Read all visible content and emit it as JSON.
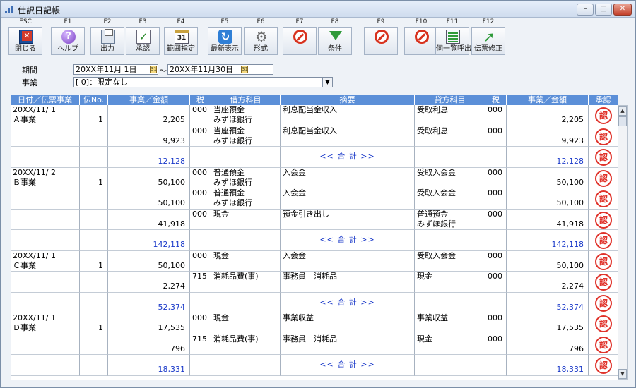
{
  "window": {
    "title": "仕訳日記帳",
    "controls": {
      "minimize": "–",
      "maximize": "□",
      "close": "✕"
    }
  },
  "toolbar": [
    {
      "key": "ESC",
      "label": "閉じる",
      "icon": "close-window-icon"
    },
    {
      "key": "F1",
      "label": "ヘルプ",
      "icon": "help-icon"
    },
    {
      "key": "F2",
      "label": "出力",
      "icon": "print-icon"
    },
    {
      "key": "F3",
      "label": "承認",
      "icon": "approve-check-icon"
    },
    {
      "key": "F4",
      "label": "範囲指定",
      "icon": "calendar-icon",
      "icon_text": "31"
    },
    {
      "key": "F5",
      "label": "最新表示",
      "icon": "refresh-icon"
    },
    {
      "key": "F6",
      "label": "形式",
      "icon": "gear-icon"
    },
    {
      "key": "F7",
      "label": "",
      "icon": "disabled-icon"
    },
    {
      "key": "F8",
      "label": "条件",
      "icon": "filter-icon"
    },
    {
      "key": "F9",
      "label": "",
      "icon": "disabled-icon"
    },
    {
      "key": "F10",
      "label": "",
      "icon": "disabled-icon"
    },
    {
      "key": "F11",
      "label": "伺一覧呼出",
      "icon": "list-icon"
    },
    {
      "key": "F12",
      "label": "伝票修正",
      "icon": "edit-arrow-icon"
    }
  ],
  "filters": {
    "period_label": "期間",
    "period_from": "20XX年11月 1日",
    "period_separator": "～",
    "period_to": "20XX年11月30日",
    "business_label": "事業",
    "business_value": "[      0]：限定なし"
  },
  "grid": {
    "headers": [
      "日付／伝票事業",
      "伝No.",
      "事業／金額",
      "税",
      "借方科目",
      "摘要",
      "貸方科目",
      "税",
      "事業／金額",
      "承認"
    ],
    "total_label": "<< 合  計 >>",
    "approval_stamp": "認",
    "rows": [
      {
        "date": "20XX/11/ 1",
        "biz": "Ａ事業",
        "no": "1",
        "d_amount": "2,205",
        "d_tax": "000",
        "d_acct": "当座預金",
        "d_sub": "みずほ銀行",
        "memo": "利息配当金収入",
        "c_acct": "受取利息",
        "c_sub": "",
        "c_tax": "000",
        "c_amount": "2,205"
      },
      {
        "date": "",
        "biz": "",
        "no": "",
        "d_amount": "9,923",
        "d_tax": "000",
        "d_acct": "当座預金",
        "d_sub": "みずほ銀行",
        "memo": "利息配当金収入",
        "c_acct": "受取利息",
        "c_sub": "",
        "c_tax": "000",
        "c_amount": "9,923"
      },
      {
        "total": true,
        "d_amount": "12,128",
        "c_amount": "12,128"
      },
      {
        "date": "20XX/11/ 2",
        "biz": "Ｂ事業",
        "no": "1",
        "d_amount": "50,100",
        "d_tax": "000",
        "d_acct": "普通預金",
        "d_sub": "みずほ銀行",
        "memo": "入会金",
        "c_acct": "受取入会金",
        "c_sub": "",
        "c_tax": "000",
        "c_amount": "50,100"
      },
      {
        "date": "",
        "biz": "",
        "no": "",
        "d_amount": "50,100",
        "d_tax": "000",
        "d_acct": "普通預金",
        "d_sub": "みずほ銀行",
        "memo": "入会金",
        "c_acct": "受取入会金",
        "c_sub": "",
        "c_tax": "000",
        "c_amount": "50,100"
      },
      {
        "date": "",
        "biz": "",
        "no": "",
        "d_amount": "41,918",
        "d_tax": "000",
        "d_acct": "現金",
        "d_sub": "",
        "memo": "預金引き出し",
        "c_acct": "普通預金",
        "c_sub": "みずほ銀行",
        "c_tax": "000",
        "c_amount": "41,918"
      },
      {
        "total": true,
        "d_amount": "142,118",
        "c_amount": "142,118"
      },
      {
        "date": "20XX/11/ 1",
        "biz": "Ｃ事業",
        "no": "1",
        "d_amount": "50,100",
        "d_tax": "000",
        "d_acct": "現金",
        "d_sub": "",
        "memo": "入会金",
        "c_acct": "受取入会金",
        "c_sub": "",
        "c_tax": "000",
        "c_amount": "50,100"
      },
      {
        "date": "",
        "biz": "",
        "no": "",
        "d_amount": "2,274",
        "d_tax": "715",
        "d_acct": "消耗品費(事)",
        "d_sub": "",
        "memo": "事務員　消耗品",
        "c_acct": "現金",
        "c_sub": "",
        "c_tax": "000",
        "c_amount": "2,274"
      },
      {
        "total": true,
        "d_amount": "52,374",
        "c_amount": "52,374"
      },
      {
        "date": "20XX/11/ 1",
        "biz": "Ｄ事業",
        "no": "1",
        "d_amount": "17,535",
        "d_tax": "000",
        "d_acct": "現金",
        "d_sub": "",
        "memo": "事業収益",
        "c_acct": "事業収益",
        "c_sub": "",
        "c_tax": "000",
        "c_amount": "17,535"
      },
      {
        "date": "",
        "biz": "",
        "no": "",
        "d_amount": "796",
        "d_tax": "715",
        "d_acct": "消耗品費(事)",
        "d_sub": "",
        "memo": "事務員　消耗品",
        "c_acct": "現金",
        "c_sub": "",
        "c_tax": "000",
        "c_amount": "796"
      },
      {
        "total": true,
        "d_amount": "18,331",
        "c_amount": "18,331"
      }
    ]
  },
  "scrollbar": {
    "up": "▲",
    "down": "▼"
  },
  "colors": {
    "header_bg": "#5b8fd8",
    "total_text": "#1b3ac9",
    "stamp": "#e0322a"
  }
}
